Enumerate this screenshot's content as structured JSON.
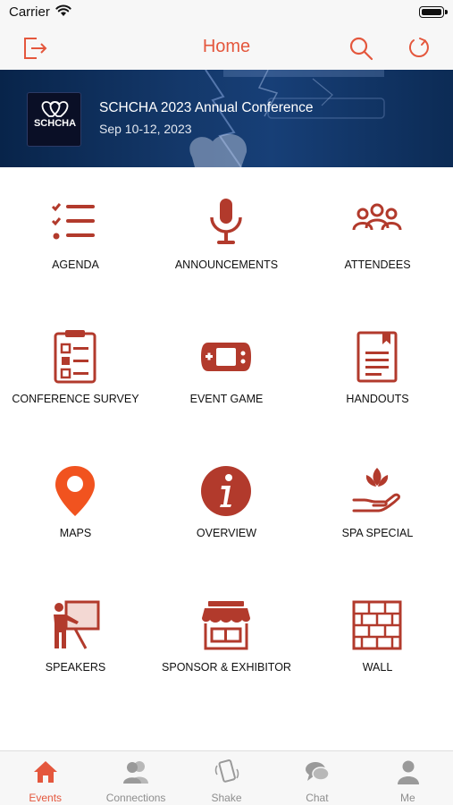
{
  "status_bar": {
    "carrier": "Carrier"
  },
  "header": {
    "title": "Home",
    "icons": [
      "logout-icon",
      "search-icon",
      "refresh-icon"
    ]
  },
  "banner": {
    "event_name": "SCHCHA 2023 Annual Conference",
    "dates": "Sep 10-12, 2023",
    "logo_text": "SCHCHA"
  },
  "grid": [
    {
      "label": "AGENDA",
      "icon": "agenda-list-icon"
    },
    {
      "label": "ANNOUNCEMENTS",
      "icon": "microphone-icon"
    },
    {
      "label": "ATTENDEES",
      "icon": "attendees-icon"
    },
    {
      "label": "CONFERENCE SURVEY",
      "icon": "clipboard-icon"
    },
    {
      "label": "EVENT GAME",
      "icon": "game-console-icon"
    },
    {
      "label": "HANDOUTS",
      "icon": "document-icon"
    },
    {
      "label": "MAPS",
      "icon": "map-pin-icon"
    },
    {
      "label": "OVERVIEW",
      "icon": "info-icon"
    },
    {
      "label": "SPA SPECIAL",
      "icon": "lotus-hand-icon"
    },
    {
      "label": "SPEAKERS",
      "icon": "speaker-presenter-icon"
    },
    {
      "label": "SPONSOR & EXHIBITOR",
      "icon": "storefront-icon"
    },
    {
      "label": "WALL",
      "icon": "brick-wall-icon"
    }
  ],
  "tabs": [
    {
      "label": "Events",
      "icon": "home-icon",
      "active": true
    },
    {
      "label": "Connections",
      "icon": "people-icon",
      "active": false
    },
    {
      "label": "Shake",
      "icon": "shake-phone-icon",
      "active": false
    },
    {
      "label": "Chat",
      "icon": "chat-bubble-icon",
      "active": false
    },
    {
      "label": "Me",
      "icon": "person-icon",
      "active": false
    }
  ],
  "colors": {
    "accent": "#e4573d",
    "icon_red": "#b23a2c",
    "map_orange": "#f1531f",
    "tab_gray": "#9a9a9a",
    "banner_navy": "#14386a"
  }
}
